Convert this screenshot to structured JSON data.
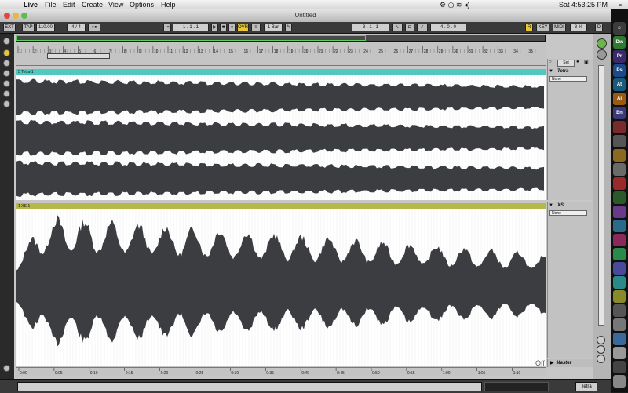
{
  "menubar": {
    "apple_icon": "apple-icon",
    "items": [
      "Live",
      "File",
      "Edit",
      "Create",
      "View",
      "Options",
      "Help"
    ],
    "clock": "Sat 4:53:25 PM"
  },
  "window": {
    "title": "Untitled"
  },
  "transport": {
    "ext": "EXT",
    "tap": "TAP",
    "tempo": "110.00",
    "time_sig": "4 / 4",
    "metronome": "○●",
    "arrangement_position": "1 . 1 . 1",
    "ovr": "OVR",
    "quantize": "1 Bar",
    "loop_start": "3 . 1 . 1",
    "loop_length": "4 . 0 . 0",
    "key": "KEY",
    "midi": "MIDI",
    "cpu": "3 %",
    "r": "R",
    "d": "D"
  },
  "ruler": {
    "bars": [
      "1",
      "2",
      "3",
      "4",
      "5",
      "6",
      "7",
      "8",
      "9",
      "10",
      "11",
      "12",
      "13",
      "14",
      "15",
      "16",
      "17",
      "18",
      "19",
      "20",
      "21",
      "22",
      "23",
      "24",
      "25",
      "26",
      "27",
      "28",
      "29",
      "30",
      "31",
      "32",
      "33",
      "34",
      "35"
    ]
  },
  "time_axis": {
    "labels": [
      "0:00",
      "0:05",
      "0:10",
      "0:15",
      "0:20",
      "0:25",
      "0:30",
      "0:35",
      "0:40",
      "0:45",
      "0:50",
      "0:55",
      "1:00",
      "1:05",
      "1:10",
      "1:15"
    ]
  },
  "tracks": [
    {
      "clip_name": "5 Tetra-1",
      "device_name": "Tetra",
      "input": "None",
      "color": "#4fc9c0"
    },
    {
      "clip_name": "1 XS-1",
      "device_name": "XS",
      "input": "None",
      "color": "#b7b84a"
    }
  ],
  "master": {
    "label": "Master",
    "off": "Off"
  },
  "set_label": "Set",
  "status": {
    "track_name": "Tetra"
  },
  "dock_icons": [
    "Dw",
    "Pr",
    "Ps",
    "At",
    "Ai",
    "En"
  ]
}
